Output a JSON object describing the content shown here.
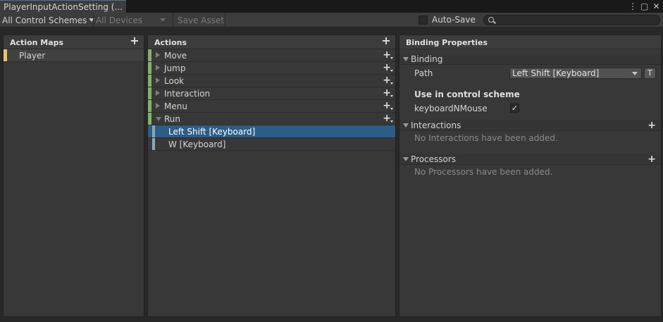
{
  "window": {
    "tab_title": "PlayerInputActionSetting (...",
    "icons": [
      "more-vert-icon",
      "maximize-icon",
      "close-icon"
    ]
  },
  "toolbar": {
    "control_scheme": "All Control Schemes",
    "devices": "All Devices",
    "save_asset": "Save Asset",
    "auto_save_label": "Auto-Save",
    "auto_save_checked": false,
    "search_placeholder": ""
  },
  "action_maps": {
    "title": "Action Maps",
    "items": [
      {
        "label": "Player",
        "selected": true,
        "color": "#e8c56a"
      }
    ]
  },
  "actions": {
    "title": "Actions",
    "items": [
      {
        "label": "Move",
        "expanded": false
      },
      {
        "label": "Jump",
        "expanded": false
      },
      {
        "label": "Look",
        "expanded": false
      },
      {
        "label": "Interaction",
        "expanded": false
      },
      {
        "label": "Menu",
        "expanded": false
      },
      {
        "label": "Run",
        "expanded": true
      }
    ],
    "bindings": [
      {
        "label": "Left Shift [Keyboard]",
        "selected": true
      },
      {
        "label": "W [Keyboard]",
        "selected": false
      }
    ],
    "action_color": "#84b26a",
    "binding_color": "#87a9b8",
    "selection_color": "#2c5d87"
  },
  "binding_properties": {
    "title": "Binding Properties",
    "binding_section": "Binding",
    "path_label": "Path",
    "path_value": "Left Shift [Keyboard]",
    "t_button": "T",
    "use_in_scheme_label": "Use in control scheme",
    "scheme_name": "keyboardNMouse",
    "scheme_checked": true,
    "interactions_section": "Interactions",
    "interactions_empty": "No Interactions have been added.",
    "processors_section": "Processors",
    "processors_empty": "No Processors have been added."
  }
}
